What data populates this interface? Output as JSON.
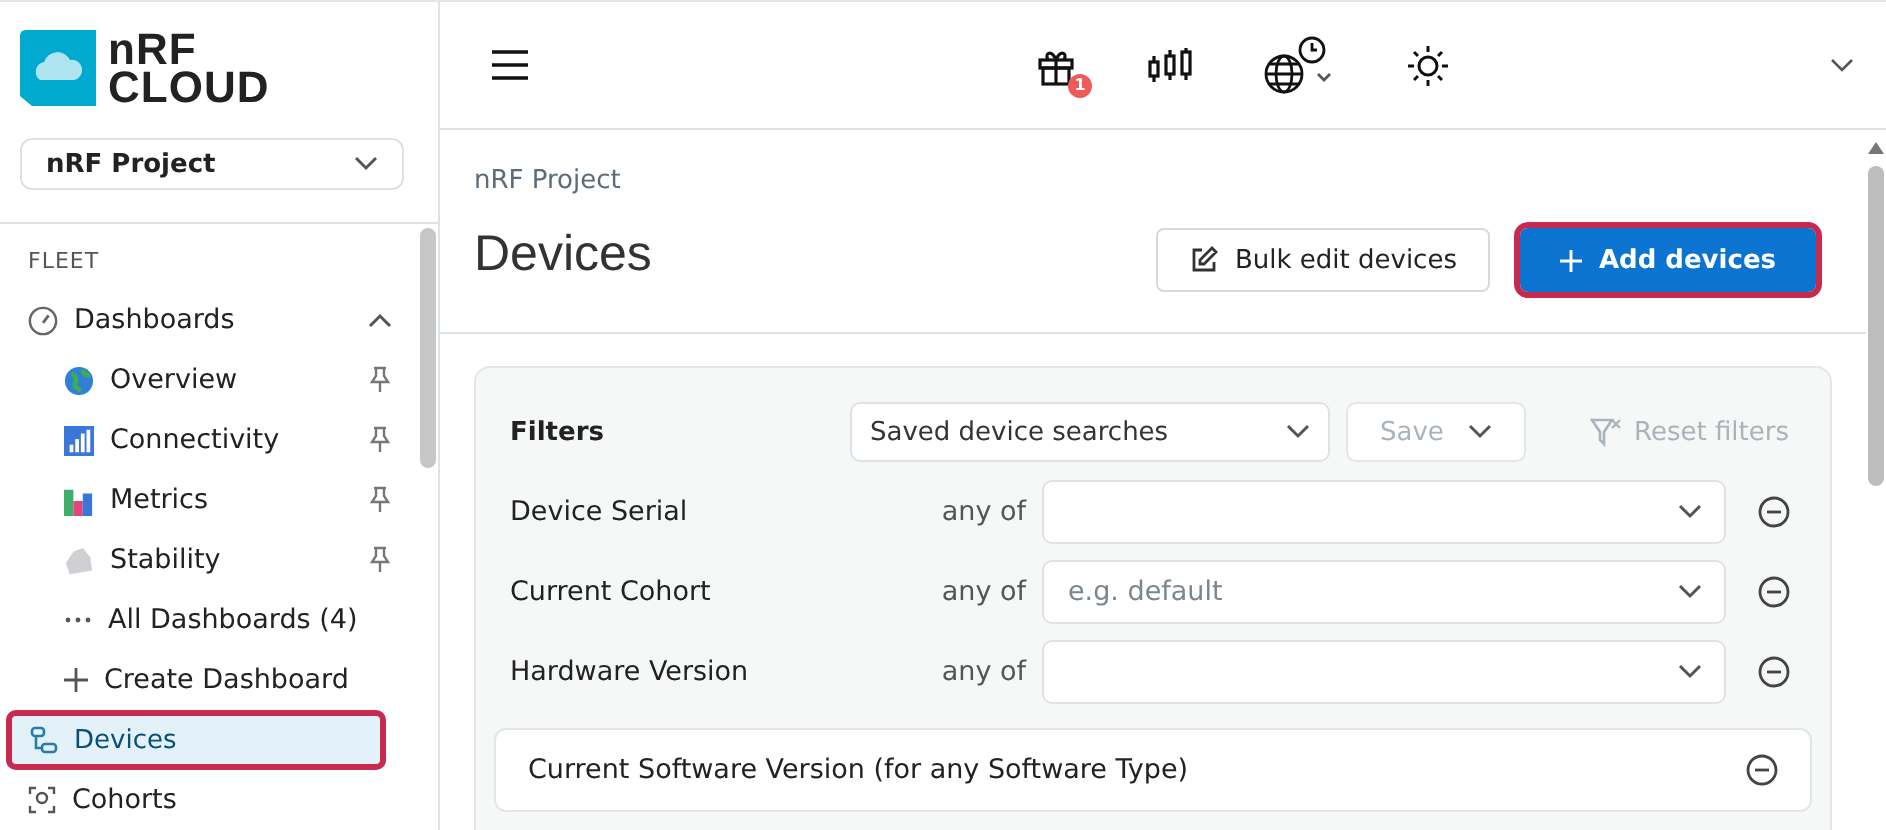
{
  "logo": {
    "line1": "nRF",
    "line2": "CLOUD"
  },
  "project_selector": {
    "value": "nRF Project"
  },
  "sidebar": {
    "section": "FLEET",
    "items": [
      {
        "label": "Dashboards",
        "kind": "group",
        "expanded": true,
        "selected": false,
        "highlighted": false,
        "children": [
          {
            "label": "Overview",
            "kind": "dashboard"
          },
          {
            "label": "Connectivity",
            "kind": "dashboard"
          },
          {
            "label": "Metrics",
            "kind": "dashboard"
          },
          {
            "label": "Stability",
            "kind": "dashboard"
          },
          {
            "label": "All Dashboards (4)",
            "kind": "more"
          },
          {
            "label": "Create Dashboard",
            "kind": "create"
          }
        ]
      },
      {
        "label": "Devices",
        "kind": "link",
        "selected": true,
        "highlighted": true
      },
      {
        "label": "Cohorts",
        "kind": "link",
        "selected": false,
        "highlighted": false
      }
    ]
  },
  "topbar": {
    "notification_count": "1"
  },
  "header": {
    "breadcrumb": "nRF Project",
    "title": "Devices",
    "buttons": [
      {
        "label": "Bulk edit devices",
        "kind": "secondary",
        "highlighted": false
      },
      {
        "label": "Add devices",
        "kind": "primary",
        "highlighted": true
      }
    ]
  },
  "filters": {
    "title": "Filters",
    "saved_searches": {
      "value": "Saved device searches"
    },
    "save": {
      "label": "Save",
      "disabled": true
    },
    "reset": {
      "label": "Reset filters",
      "disabled": true
    },
    "rows": [
      {
        "label": "Device Serial",
        "operator": "any of"
      },
      {
        "label": "Current Cohort",
        "operator": "any of",
        "placeholder": "e.g. default"
      },
      {
        "label": "Hardware Version",
        "operator": "any of"
      }
    ],
    "groups": [
      {
        "title": "Current Software Version (for any Software Type)"
      }
    ]
  }
}
